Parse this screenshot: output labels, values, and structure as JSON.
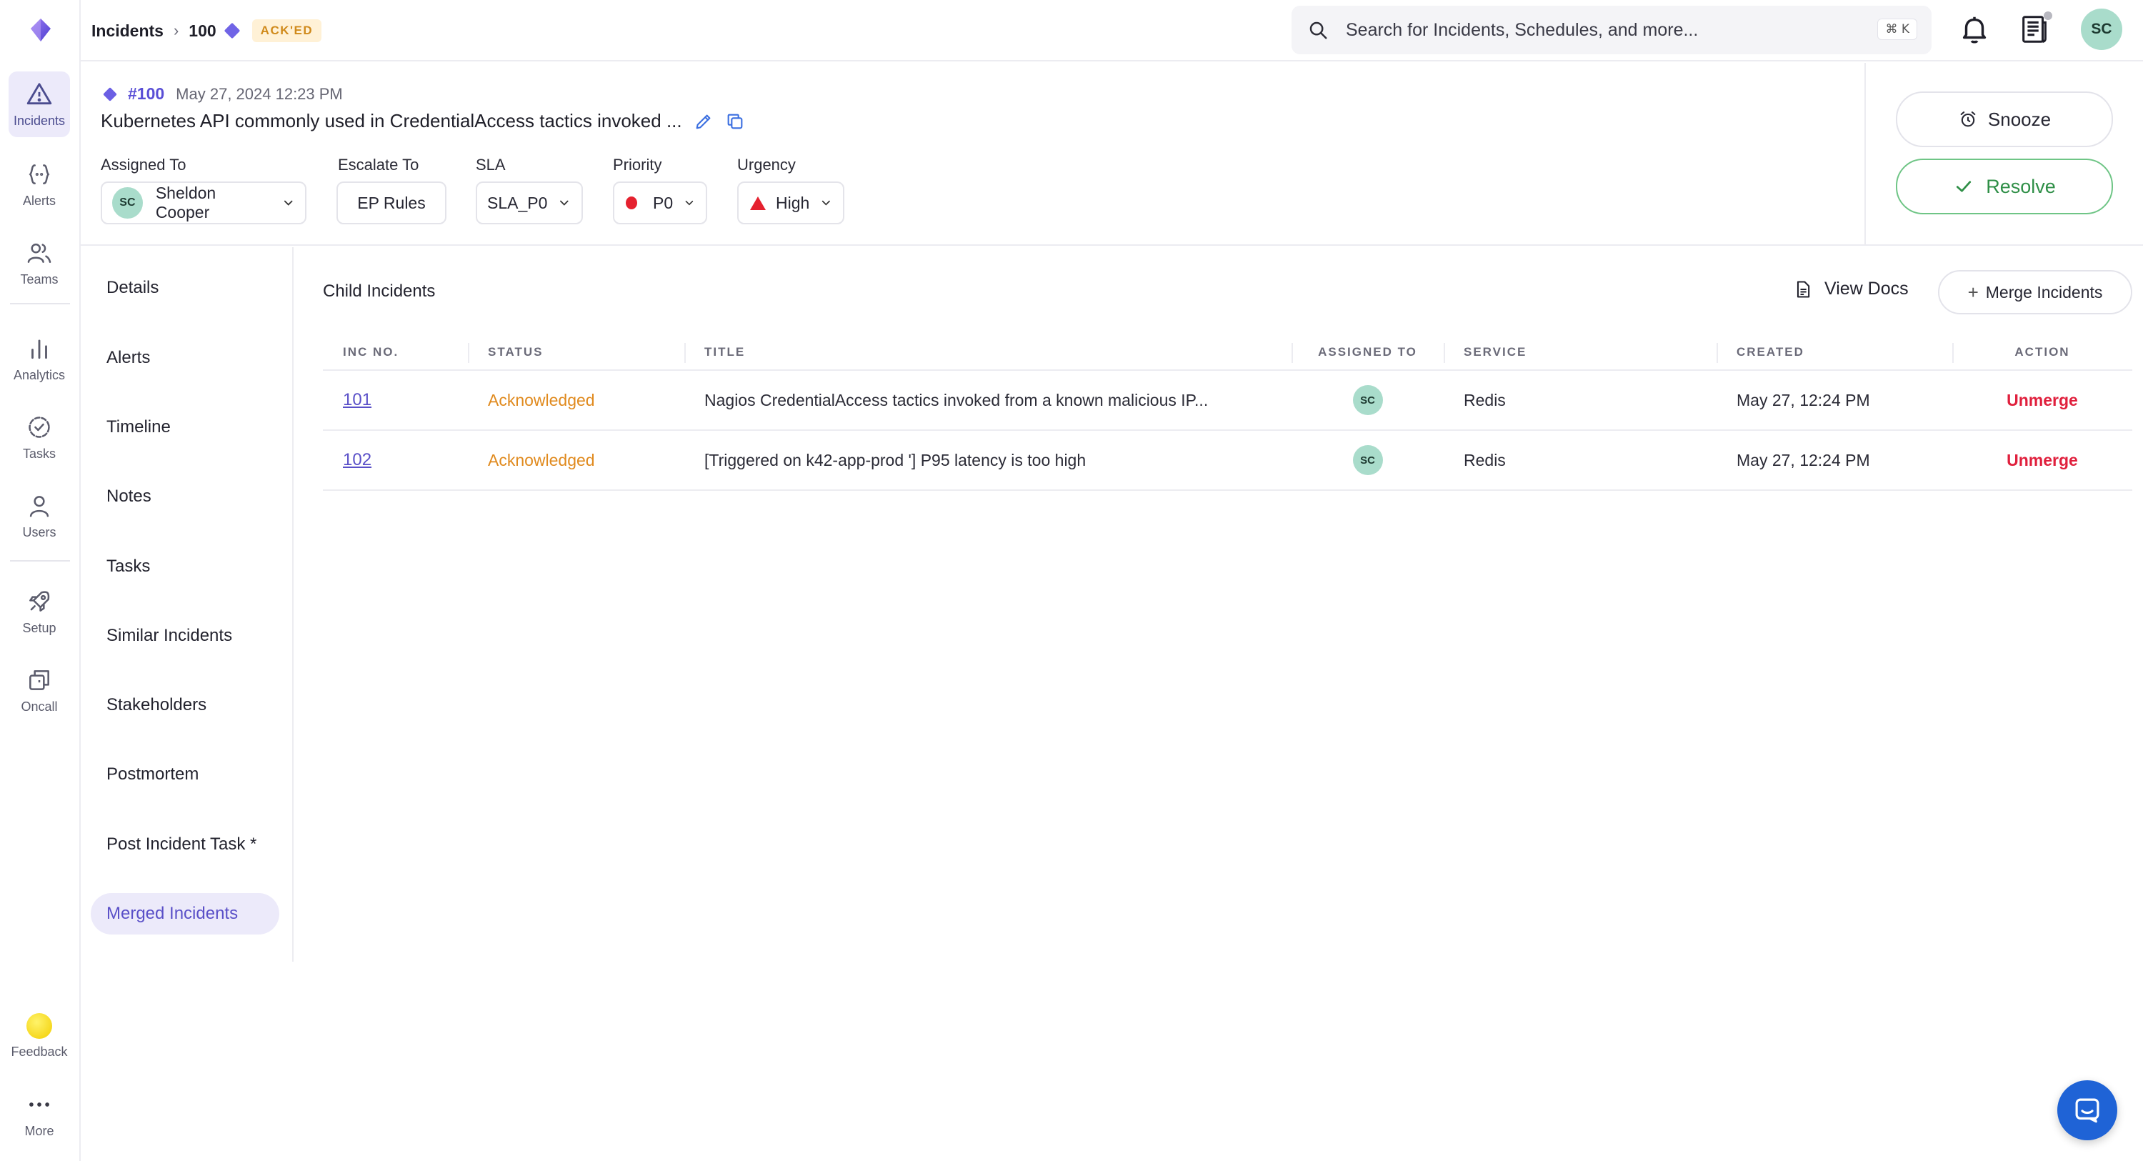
{
  "breadcrumb": {
    "root": "Incidents",
    "current": "100",
    "badge": "ACK'ED"
  },
  "search": {
    "placeholder": "Search for Incidents, Schedules, and more...",
    "shortcut": "⌘ K"
  },
  "user": {
    "initials": "SC"
  },
  "rail": {
    "items": [
      {
        "label": "Incidents",
        "icon": "warning-triangle-icon",
        "active": true
      },
      {
        "label": "Alerts",
        "icon": "braces-icon"
      },
      {
        "label": "Teams",
        "icon": "team-icon"
      },
      {
        "label": "Analytics",
        "icon": "bar-chart-icon"
      },
      {
        "label": "Tasks",
        "icon": "task-check-icon"
      },
      {
        "label": "Users",
        "icon": "user-icon"
      },
      {
        "label": "Setup",
        "icon": "rocket-icon"
      },
      {
        "label": "Oncall",
        "icon": "oncall-icon"
      }
    ],
    "feedback": "Feedback",
    "more": "More"
  },
  "incident": {
    "id": "#100",
    "date": "May 27, 2024 12:23 PM",
    "title": "Kubernetes API commonly used in CredentialAccess tactics invoked ...",
    "fields": {
      "assigned_to": {
        "label": "Assigned To",
        "value": "Sheldon Cooper",
        "initials": "SC"
      },
      "escalate_to": {
        "label": "Escalate To",
        "value": "EP Rules"
      },
      "sla": {
        "label": "SLA",
        "value": "SLA_P0"
      },
      "priority": {
        "label": "Priority",
        "value": "P0"
      },
      "urgency": {
        "label": "Urgency",
        "value": "High"
      }
    }
  },
  "actions": {
    "snooze": "Snooze",
    "resolve": "Resolve"
  },
  "subnav": [
    {
      "label": "Details"
    },
    {
      "label": "Alerts"
    },
    {
      "label": "Timeline"
    },
    {
      "label": "Notes"
    },
    {
      "label": "Tasks"
    },
    {
      "label": "Similar Incidents"
    },
    {
      "label": "Stakeholders"
    },
    {
      "label": "Postmortem"
    },
    {
      "label": "Post Incident Task *"
    },
    {
      "label": "Merged Incidents",
      "active": true
    }
  ],
  "content": {
    "title": "Child Incidents",
    "view_docs": "View Docs",
    "merge_button": "Merge Incidents",
    "columns": [
      "INC NO.",
      "STATUS",
      "TITLE",
      "ASSIGNED TO",
      "SERVICE",
      "CREATED",
      "ACTION"
    ],
    "rows": [
      {
        "inc": "101",
        "status": "Acknowledged",
        "title": "Nagios CredentialAccess tactics invoked from a known malicious IP...",
        "assignee": "SC",
        "service": "Redis",
        "created": "May 27, 12:24 PM",
        "action": "Unmerge"
      },
      {
        "inc": "102",
        "status": "Acknowledged",
        "title": "[Triggered on k42-app-prod '] P95 latency is too high",
        "assignee": "SC",
        "service": "Redis",
        "created": "May 27, 12:24 PM",
        "action": "Unmerge"
      }
    ]
  },
  "colors": {
    "accent": "#5a50c8",
    "ack": "#e08a1e",
    "danger": "#e0203d",
    "resolve": "#2f8f47"
  }
}
